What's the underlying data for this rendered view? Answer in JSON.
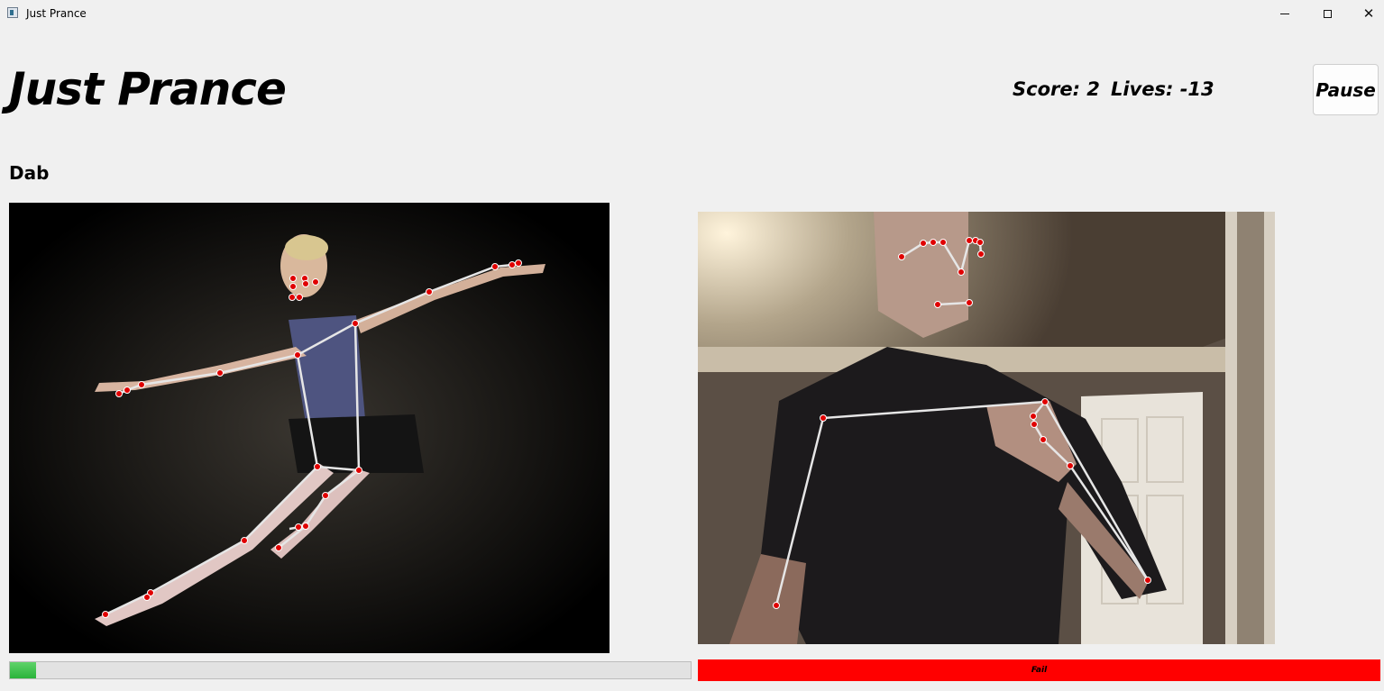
{
  "window": {
    "title": "Just Prance",
    "icons": {
      "app": "app-icon",
      "minimize": "minimize-icon",
      "maximize": "maximize-icon",
      "close": "close-icon"
    }
  },
  "header": {
    "game_title": "Just Prance",
    "score_text": "Score: 2",
    "lives_text": "Lives: -13",
    "pause_label": "Pause"
  },
  "pose": {
    "name": "Dab"
  },
  "progress": {
    "fraction": 0.038,
    "color": "#2ab33a"
  },
  "status": {
    "text": "Fail",
    "color": "#ff0000"
  },
  "colors": {
    "keypoint": "#e00000",
    "skeleton": "#e6e6e6",
    "background": "#f0f0f0"
  }
}
